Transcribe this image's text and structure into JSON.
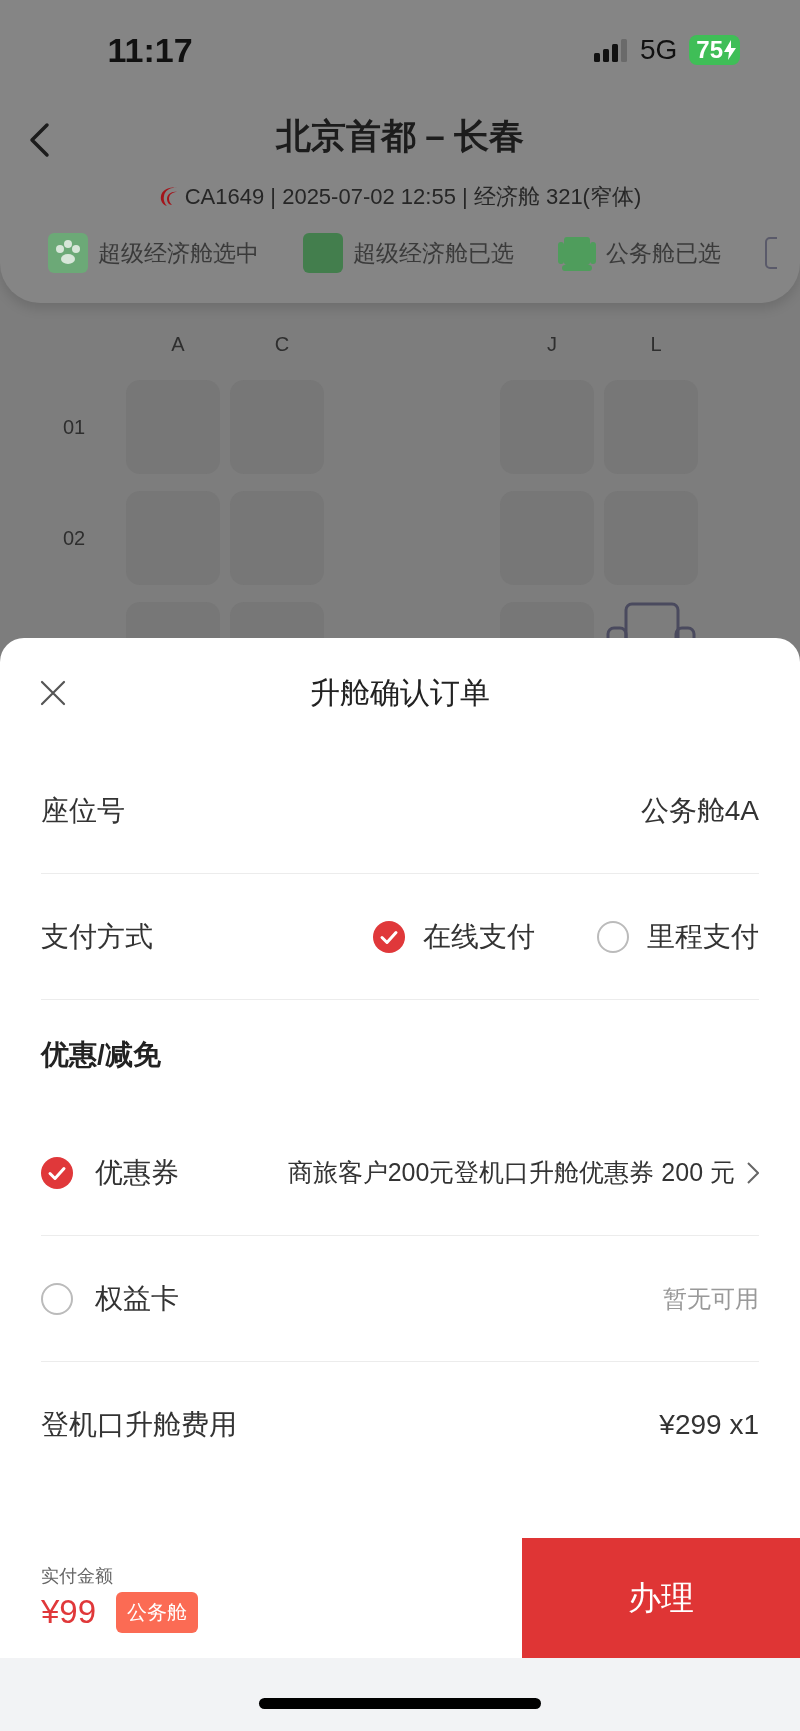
{
  "status_bar": {
    "time": "11:17",
    "network": "5G",
    "battery": "75",
    "charging": true
  },
  "header": {
    "title": "北京首都 – 长春",
    "flight_info": "CA1649 | 2025-07-02 12:55 | 经济舱 321(窄体)",
    "legend": [
      {
        "kind": "selecting",
        "label": "超级经济舱选中"
      },
      {
        "kind": "selected",
        "label": "超级经济舱已选"
      },
      {
        "kind": "business",
        "label": "公务舱已选"
      },
      {
        "kind": "other"
      }
    ]
  },
  "seat_map": {
    "columns": [
      "A",
      "C",
      "J",
      "L"
    ],
    "rows": [
      {
        "label": "01",
        "seats": [
          {
            "kind": "blocked"
          },
          {
            "kind": "blocked"
          },
          {
            "kind": "blocked"
          },
          {
            "kind": "blocked"
          }
        ]
      },
      {
        "label": "02",
        "seats": [
          {
            "kind": "blocked"
          },
          {
            "kind": "blocked"
          },
          {
            "kind": "blocked"
          },
          {
            "kind": "blocked"
          }
        ]
      },
      {
        "seats": [
          {
            "kind": "blocked"
          },
          {
            "kind": "blocked"
          },
          {
            "kind": "blocked"
          },
          {
            "kind": "business"
          }
        ]
      }
    ]
  },
  "order_sheet": {
    "title": "升舱确认订单",
    "seat": {
      "label": "座位号",
      "value": "公务舱4A"
    },
    "payment": {
      "label": "支付方式",
      "options": [
        {
          "label": "在线支付",
          "selected": true
        },
        {
          "label": "里程支付",
          "selected": false
        }
      ]
    },
    "discount_heading": "优惠/减免",
    "discounts": [
      {
        "label": "优惠券",
        "checked": true,
        "value": "商旅客户200元登机口升舱优惠券 200 元",
        "available": true
      },
      {
        "label": "权益卡",
        "checked": false,
        "value": "暂无可用",
        "available": false
      }
    ],
    "fee": {
      "label": "登机口升舱费用",
      "value": "¥299 x1"
    },
    "footer": {
      "total_label": "实付金额",
      "total": "¥99",
      "badge": "公务舱",
      "submit": "办理"
    }
  }
}
